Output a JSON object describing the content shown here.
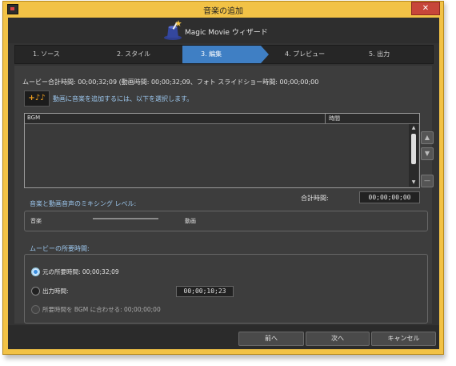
{
  "window": {
    "title": "音楽の追加"
  },
  "header": {
    "title": "Magic Movie ウィザード",
    "icon": "magic-hat-icon"
  },
  "steps": [
    {
      "label": "1. ソース"
    },
    {
      "label": "2. スタイル"
    },
    {
      "label": "3. 編集",
      "active": true
    },
    {
      "label": "4. プレビュー"
    },
    {
      "label": "5. 出力"
    }
  ],
  "info": {
    "text": "ムービー合計時間: 00;00;32;09 (動画時間: 00;00;32;09、フォト スライドショー時間: 00;00;00;00"
  },
  "add_music": {
    "icon": "add-music-icon",
    "icon_text": "+♪♪",
    "hint": "動画に音楽を追加するには、以下を選択します。"
  },
  "bgm_table": {
    "columns": [
      "BGM",
      "時間"
    ],
    "rows": []
  },
  "side_buttons": {
    "up": "▲",
    "down": "▼",
    "remove": "—"
  },
  "total": {
    "label": "合計時間:",
    "value": "00;00;00;00"
  },
  "mixing": {
    "label": "音楽と動画音声のミキシング レベル:",
    "left": "音楽",
    "right": "動画"
  },
  "duration": {
    "label": "ムービーの所要時間:",
    "options": [
      {
        "label": "元の所要時間: 00;00;32;09",
        "selected": true
      },
      {
        "label": "出力時間:",
        "value": "00;00;10;23",
        "selected": false
      },
      {
        "label": "所要時間を BGM に合わせる: 00;00;00;00",
        "selected": false,
        "disabled": true
      }
    ]
  },
  "footer": {
    "back": "前へ",
    "next": "次へ",
    "cancel": "キャンセル"
  },
  "colors": {
    "accent": "#3a8ede",
    "active_step": "#3f7fc4",
    "hint": "#9cc7ee",
    "frame": "#f2c246"
  }
}
